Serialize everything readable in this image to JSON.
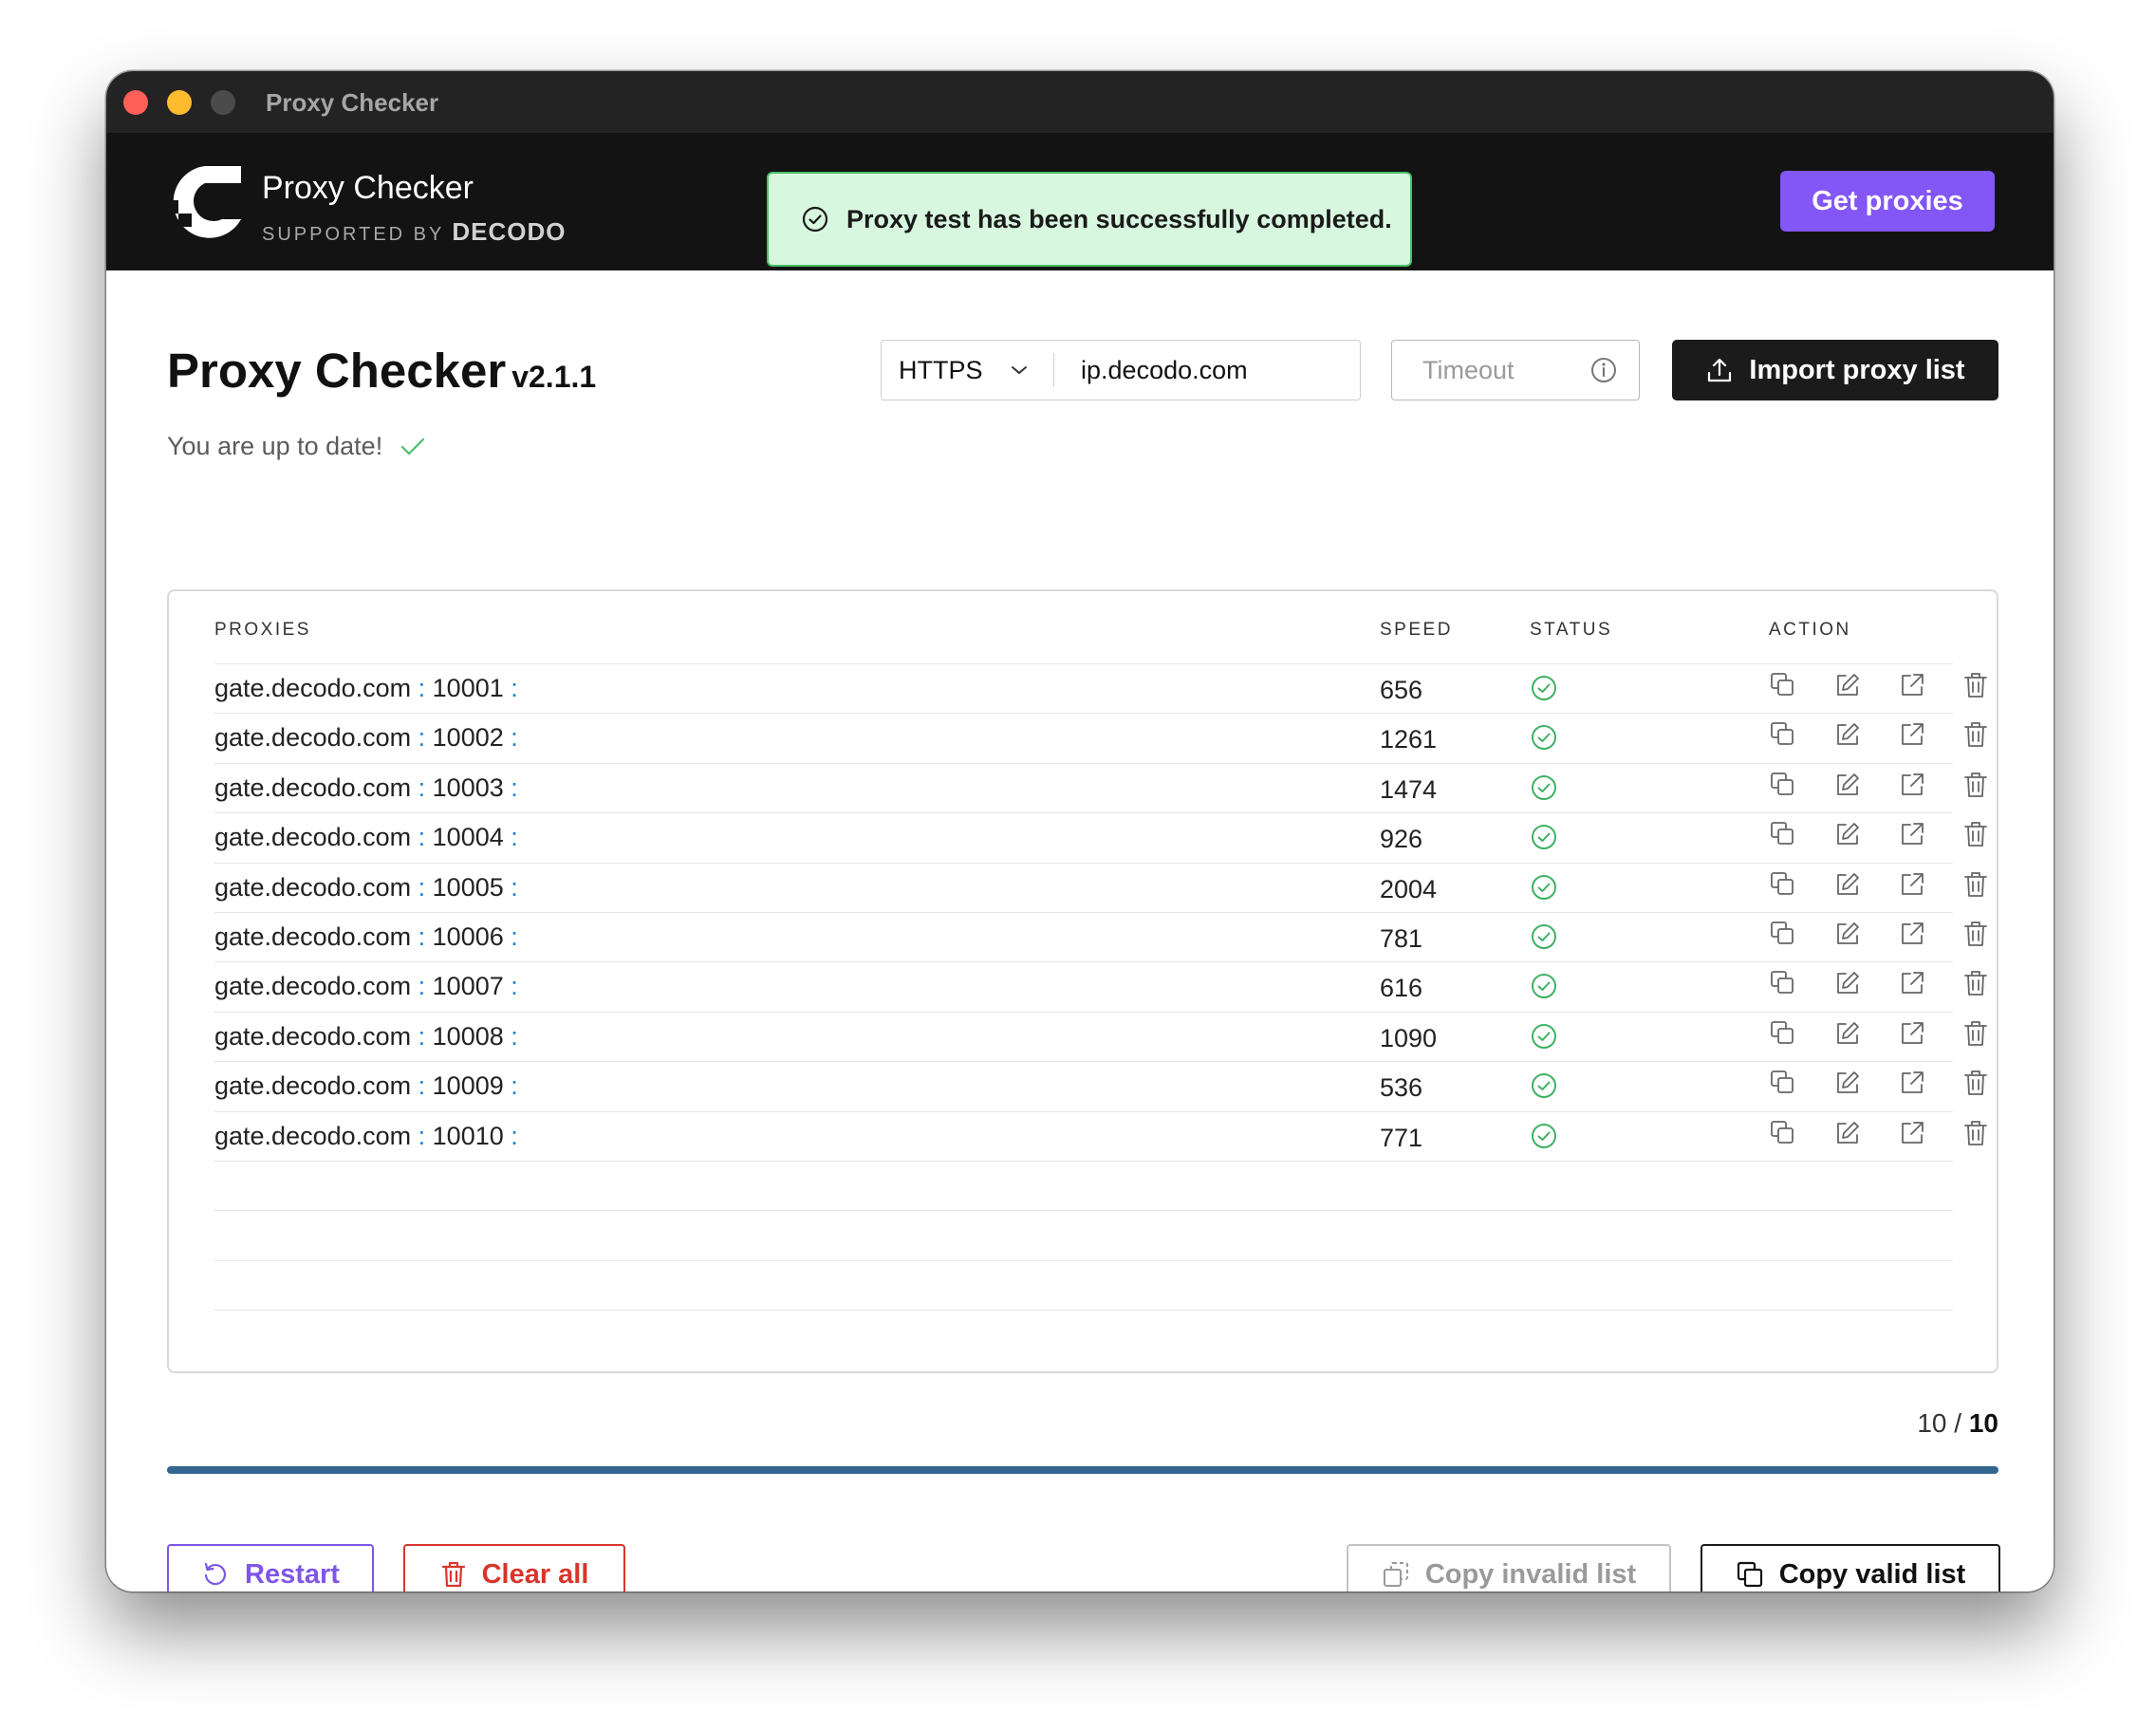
{
  "window": {
    "title": "Proxy Checker"
  },
  "header": {
    "brand_name": "Proxy Checker",
    "supported_by": "SUPPORTED BY",
    "partner": "DECODO",
    "toast": "Proxy test has been successfully completed.",
    "get_proxies": "Get proxies"
  },
  "main": {
    "title": "Proxy Checker",
    "version": "v2.1.1",
    "update_status": "You are up to date!",
    "protocol": "HTTPS",
    "target_url": "ip.decodo.com",
    "timeout_placeholder": "Timeout",
    "import_label": "Import proxy list"
  },
  "table": {
    "headers": {
      "proxies": "PROXIES",
      "speed": "SPEED",
      "status": "STATUS",
      "action": "ACTION"
    },
    "rows": [
      {
        "host": "gate.decodo.com",
        "port": "10001",
        "speed": "656",
        "status": "valid"
      },
      {
        "host": "gate.decodo.com",
        "port": "10002",
        "speed": "1261",
        "status": "valid"
      },
      {
        "host": "gate.decodo.com",
        "port": "10003",
        "speed": "1474",
        "status": "valid"
      },
      {
        "host": "gate.decodo.com",
        "port": "10004",
        "speed": "926",
        "status": "valid"
      },
      {
        "host": "gate.decodo.com",
        "port": "10005",
        "speed": "2004",
        "status": "valid"
      },
      {
        "host": "gate.decodo.com",
        "port": "10006",
        "speed": "781",
        "status": "valid"
      },
      {
        "host": "gate.decodo.com",
        "port": "10007",
        "speed": "616",
        "status": "valid"
      },
      {
        "host": "gate.decodo.com",
        "port": "10008",
        "speed": "1090",
        "status": "valid"
      },
      {
        "host": "gate.decodo.com",
        "port": "10009",
        "speed": "536",
        "status": "valid"
      },
      {
        "host": "gate.decodo.com",
        "port": "10010",
        "speed": "771",
        "status": "valid"
      }
    ],
    "empty_rows": 3,
    "action_icons": [
      "copy-icon",
      "edit-icon",
      "open-external-icon",
      "trash-icon"
    ]
  },
  "progress": {
    "done": "10",
    "total": "10",
    "separator": "/",
    "fraction": 1.0
  },
  "footer": {
    "restart": "Restart",
    "clear_all": "Clear all",
    "copy_invalid": "Copy invalid list",
    "copy_valid": "Copy valid list"
  },
  "colors": {
    "accent_purple": "#8356f6",
    "danger_red": "#d9352b",
    "success_green": "#4bbf6b",
    "progress_blue": "#33658e",
    "header_bg": "#131313",
    "link_blue": "#1b7fd1"
  }
}
